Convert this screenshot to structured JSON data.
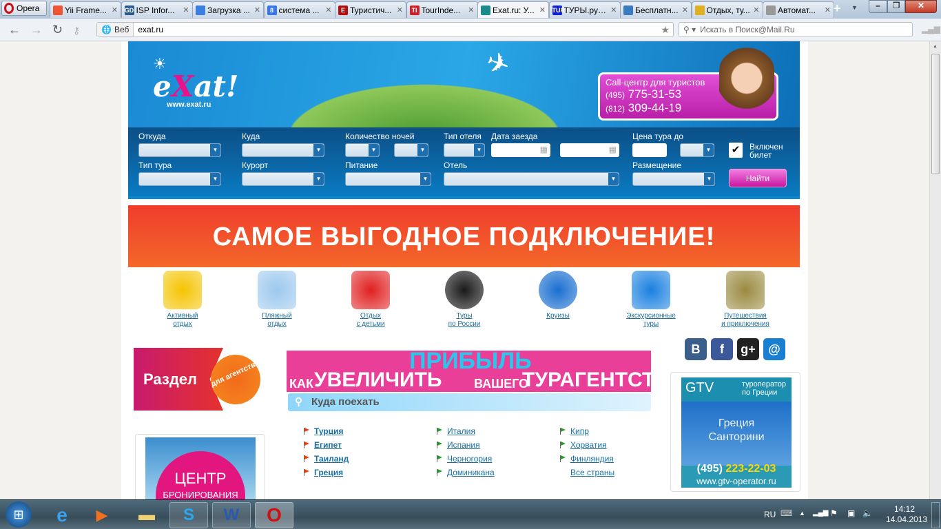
{
  "browser": {
    "menu_label": "Opera",
    "tabs": [
      {
        "title": "Yii Frame...",
        "color": "#e53"
      },
      {
        "title": "ISP Infor...",
        "color": "#2a5a8a",
        "icon_text": "GD"
      },
      {
        "title": "Загрузка ...",
        "color": "#3d7fe0"
      },
      {
        "title": "система ...",
        "color": "#3b78e7",
        "icon_text": "8"
      },
      {
        "title": "Туристич...",
        "color": "#b01010",
        "icon_text": "E"
      },
      {
        "title": "TourInde...",
        "color": "#d0202a",
        "icon_text": "TI"
      },
      {
        "title": "Exat.ru: У...",
        "color": "#1a8a8a",
        "active": true
      },
      {
        "title": "ТУРЫ.ру :...",
        "color": "#1020d0",
        "icon_text": "TURY"
      },
      {
        "title": "Бесплатн...",
        "color": "#3a7ac0"
      },
      {
        "title": "Отдых, ту...",
        "color": "#e0b020"
      },
      {
        "title": "Автомат...",
        "color": "#999"
      }
    ],
    "address_label": "Веб",
    "url": "exat.ru",
    "search_placeholder": "Искать в Поиск@Mail.Ru"
  },
  "header": {
    "logo_text": "eXat!",
    "logo_url": "www.exat.ru",
    "call_title": "Call-центр для туристов",
    "phone1_code": "(495)",
    "phone1": "775-31-53",
    "phone2_code": "(812)",
    "phone2": "309-44-19"
  },
  "search_form": {
    "from": "Откуда",
    "to": "Куда",
    "nights": "Количество ночей",
    "hotel_type": "Тип отеля",
    "date": "Дата заезда",
    "price": "Цена тура до",
    "ticket_included": "Включен билет",
    "ticket_checked": true,
    "tour_type": "Тип тура",
    "resort": "Курорт",
    "meals": "Питание",
    "hotel": "Отель",
    "accommodation": "Размещение",
    "find_button": "Найти"
  },
  "promo": "САМОЕ ВЫГОДНОЕ ПОДКЛЮЧЕНИЕ!",
  "categories": [
    {
      "label": "Активный\nотдых",
      "color": "#f5c400"
    },
    {
      "label": "Пляжный\nотдых",
      "color": "#9cc8ee"
    },
    {
      "label": "Отдых\nс детьми",
      "color": "#e02020"
    },
    {
      "label": "Туры\nпо России",
      "color": "#1a1a1a"
    },
    {
      "label": "Круизы",
      "color": "#1a6fd0"
    },
    {
      "label": "Экскурсионные\nтуры",
      "color": "#1a80e0"
    },
    {
      "label": "Путешествия\nи приключения",
      "color": "#9a8a40"
    }
  ],
  "agent_banner": {
    "title": "Раздел",
    "badge": "для агентств"
  },
  "booking_banner": {
    "title": "ЦЕНТР",
    "subtitle": "БРОНИРОВАНИЯ"
  },
  "profit_banner": {
    "w1": "КАК",
    "w2": "УВЕЛИЧИТЬ",
    "w3": "ПРИБЫЛЬ",
    "w4": "ВАШЕГО",
    "w5": "ТУРАГЕНТСТВА?"
  },
  "where_to_go": {
    "title": "Куда поехать",
    "columns": [
      [
        {
          "name": "Турция",
          "bold": true
        },
        {
          "name": "Египет",
          "bold": true
        },
        {
          "name": "Таиланд",
          "bold": true
        },
        {
          "name": "Греция",
          "bold": true
        }
      ],
      [
        {
          "name": "Италия"
        },
        {
          "name": "Испания"
        },
        {
          "name": "Черногория"
        },
        {
          "name": "Доминикана"
        }
      ],
      [
        {
          "name": "Кипр"
        },
        {
          "name": "Хорватия"
        },
        {
          "name": "Финляндия"
        },
        {
          "name": "Все страны",
          "noflag": true
        }
      ]
    ]
  },
  "social": [
    {
      "label": "B",
      "color": "#3a5f8a"
    },
    {
      "label": "f",
      "color": "#3b5998"
    },
    {
      "label": "g+",
      "color": "#222"
    },
    {
      "label": "@",
      "color": "#1a7fd0"
    }
  ],
  "gtv_ad": {
    "brand": "GTV",
    "tagline": "туроператор по Греции",
    "line1": "Греция",
    "line2": "Санторини",
    "phone_code": "(495)",
    "phone": "223-22-03",
    "url": "www.gtv-operator.ru"
  },
  "taskbar": {
    "lang": "RU",
    "time": "14:12",
    "date": "14.04.2013"
  }
}
